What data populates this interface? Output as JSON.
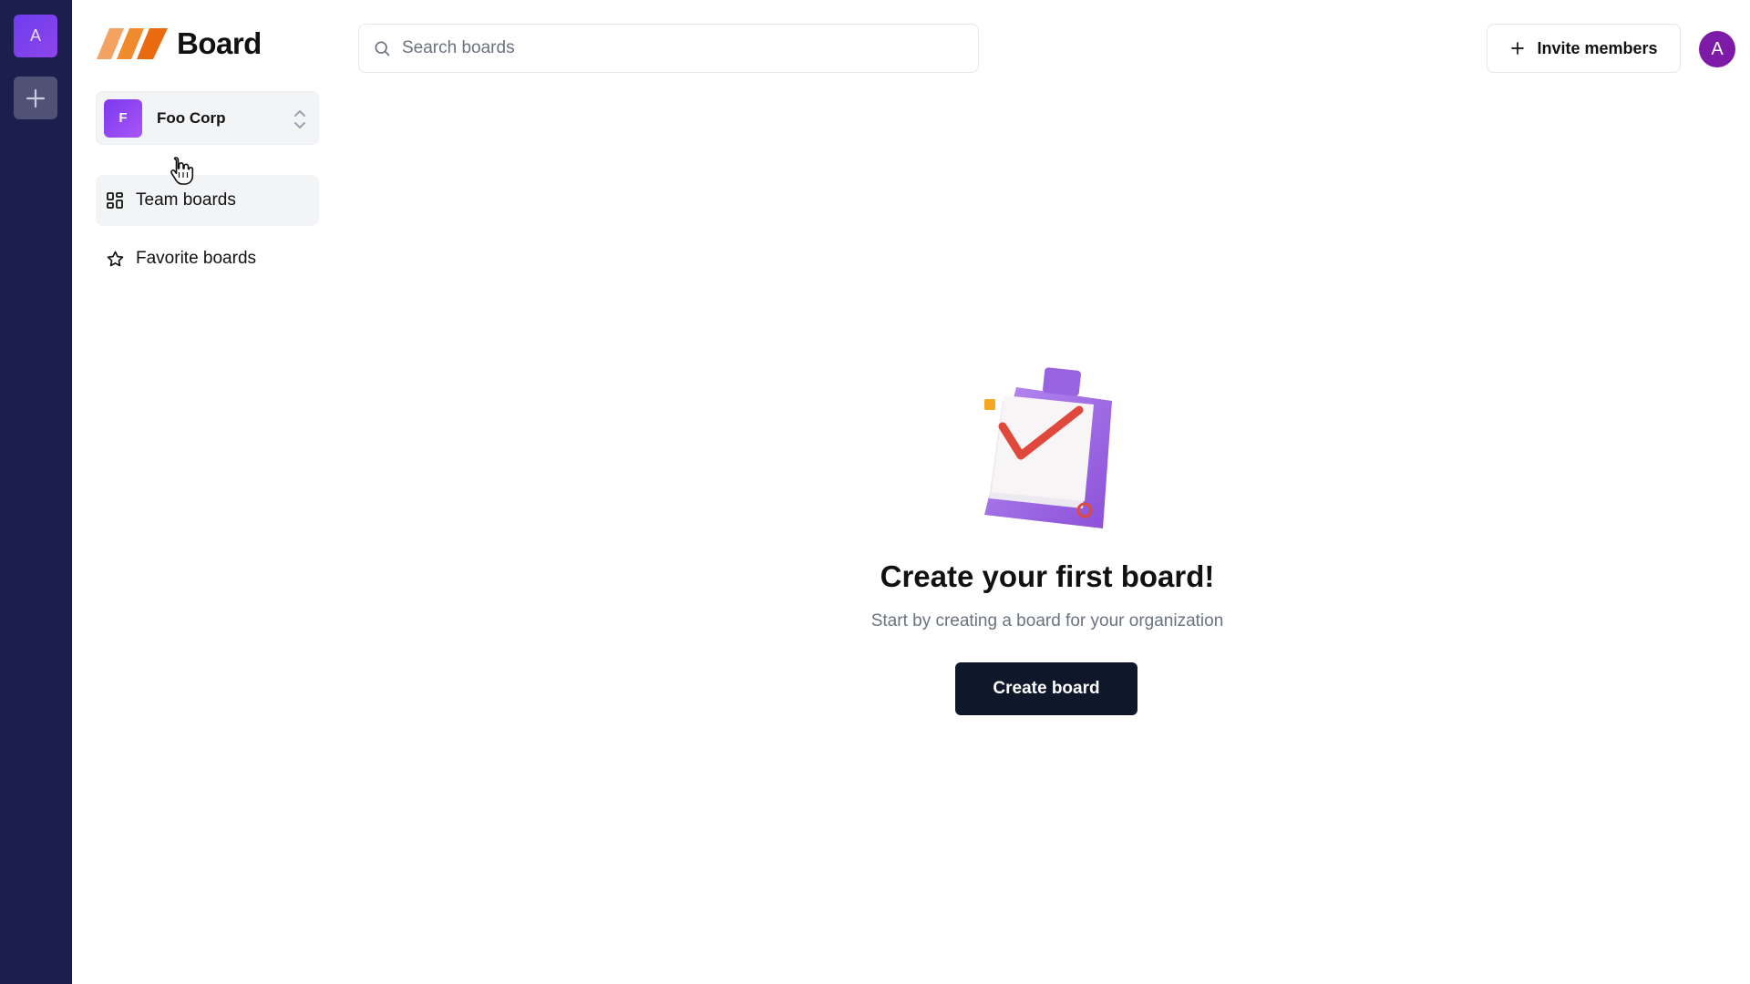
{
  "rail": {
    "org_initial": "A",
    "add_icon": "plus-icon"
  },
  "brand": {
    "name": "Board",
    "colors": [
      "#f4a261",
      "#f08a2c",
      "#ea6a10"
    ]
  },
  "org_switcher": {
    "initial": "F",
    "name": "Foo Corp",
    "icon": "chevrons-up-down-icon"
  },
  "nav": {
    "items": [
      {
        "label": "Team boards",
        "icon": "dashboard-grid-icon",
        "active": true
      },
      {
        "label": "Favorite boards",
        "icon": "star-icon",
        "active": false
      }
    ]
  },
  "search": {
    "placeholder": "Search boards",
    "value": ""
  },
  "header": {
    "invite_label": "Invite members",
    "user_initial": "A"
  },
  "empty_state": {
    "title": "Create your first board!",
    "subtitle": "Start by creating a board for your organization",
    "button_label": "Create board",
    "illustration": "clipboard-checkmark-illustration"
  },
  "colors": {
    "rail_bg": "#1c1f4d",
    "accent_purple": "#7c3aed",
    "primary_button": "#0f172a",
    "user_avatar": "#7e1aa8"
  }
}
